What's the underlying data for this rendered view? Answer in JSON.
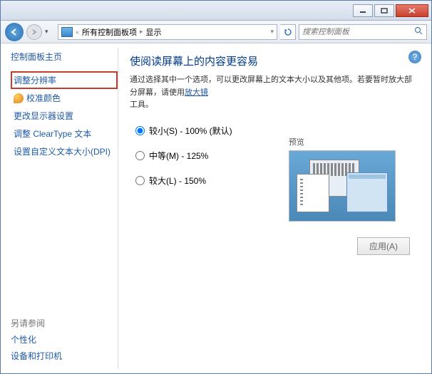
{
  "nav": {
    "breadcrumb_parent": "所有控制面板项",
    "breadcrumb_current": "显示",
    "search_placeholder": "搜索控制面板"
  },
  "sidebar": {
    "heading": "控制面板主页",
    "links": {
      "resolution": "调整分辨率",
      "calibrate": "校准颜色",
      "display_settings": "更改显示器设置",
      "cleartype": "调整 ClearType 文本",
      "dpi": "设置自定义文本大小(DPI)"
    },
    "footer": {
      "heading": "另请参阅",
      "personalize": "个性化",
      "devices": "设备和打印机"
    }
  },
  "content": {
    "title": "使阅读屏幕上的内容更容易",
    "desc_pre": "通过选择其中一个选项，可以更改屏幕上的文本大小以及其他项。若要暂时放大部分屏幕，请使用",
    "desc_link": "放大镜",
    "desc_post": "工具。",
    "options": {
      "small": "较小(S) - 100% (默认)",
      "medium": "中等(M) - 125%",
      "large": "较大(L) - 150%"
    },
    "preview_label": "预览",
    "apply": "应用(A)"
  }
}
